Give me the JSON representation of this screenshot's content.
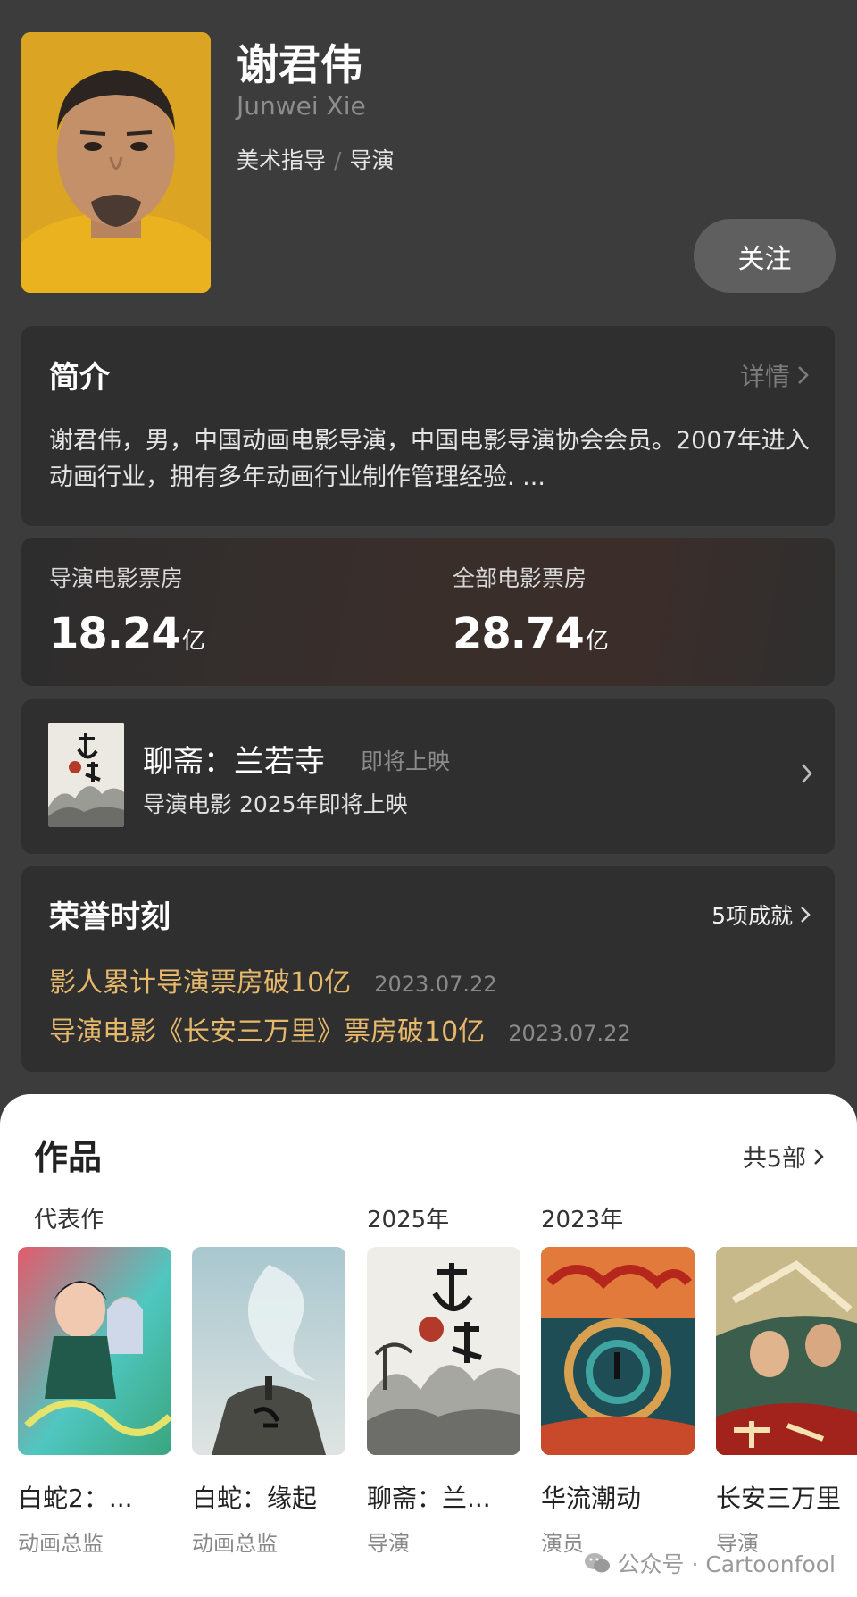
{
  "profile": {
    "name": "谢君伟",
    "name_en": "Junwei Xie",
    "role_1": "美术指导",
    "role_sep": "/",
    "role_2": "导演",
    "follow_label": "关注"
  },
  "intro": {
    "title": "简介",
    "more_label": "详情",
    "text": "谢君伟，男，中国动画电影导演，中国电影导演协会会员。2007年进入动画行业，拥有多年动画行业制作管理经验. ..."
  },
  "boxoffice": {
    "directed": {
      "label": "导演电影票房",
      "value": "18.24",
      "unit": "亿"
    },
    "all": {
      "label": "全部电影票房",
      "value": "28.74",
      "unit": "亿"
    }
  },
  "upcoming": {
    "title": "聊斋：兰若寺",
    "tag": "即将上映",
    "subtitle": "导演电影 2025年即将上映"
  },
  "honors": {
    "title": "荣誉时刻",
    "count_label": "5项成就",
    "items": [
      {
        "text": "影人累计导演票房破10亿",
        "date": "2023.07.22"
      },
      {
        "text": "导演电影《长安三万里》票房破10亿",
        "date": "2023.07.22"
      }
    ]
  },
  "works": {
    "title": "作品",
    "count_label": "共5部",
    "groups": [
      "代表作",
      "2025年",
      "2023年"
    ],
    "films": [
      {
        "title": "白蛇2：...",
        "role": "动画总监"
      },
      {
        "title": "白蛇：缘起",
        "role": "动画总监"
      },
      {
        "title": "聊斋：兰...",
        "role": "导演"
      },
      {
        "title": "华流潮动",
        "role": "演员"
      },
      {
        "title": "长安三万里",
        "role": "导演"
      }
    ]
  },
  "watermark": "公众号 · Cartoonfool",
  "colors": {
    "background": "#3c3c3c",
    "card": "#2f2f2f",
    "honor_text": "#e6b86b",
    "sheet": "#ffffff"
  }
}
